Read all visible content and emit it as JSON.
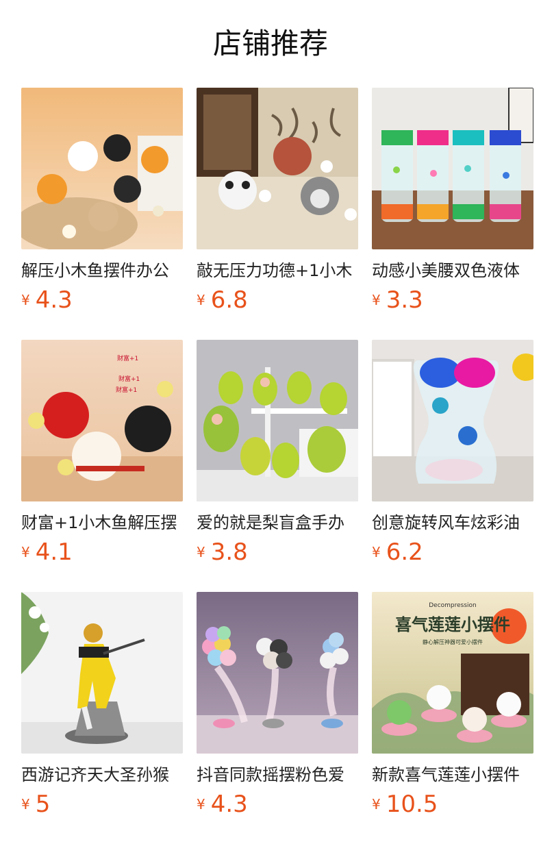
{
  "title": "店铺推荐",
  "products": [
    {
      "name": "解压小木鱼摆件办公",
      "currency": "¥",
      "price": "4.3"
    },
    {
      "name": "敲无压力功德+1小木",
      "currency": "¥",
      "price": "6.8"
    },
    {
      "name": "动感小美腰双色液体",
      "currency": "¥",
      "price": "3.3"
    },
    {
      "name": "财富+1小木鱼解压摆",
      "currency": "¥",
      "price": "4.1"
    },
    {
      "name": "爱的就是梨盲盒手办",
      "currency": "¥",
      "price": "3.8"
    },
    {
      "name": "创意旋转风车炫彩油",
      "currency": "¥",
      "price": "6.2"
    },
    {
      "name": "西游记齐天大圣孙猴",
      "currency": "¥",
      "price": "5"
    },
    {
      "name": "抖音同款摇摆粉色爱",
      "currency": "¥",
      "price": "4.3"
    },
    {
      "name": "新款喜气莲莲小摆件",
      "currency": "¥",
      "price": "10.5"
    }
  ],
  "image_text": {
    "banner_small": "Decompression",
    "banner_title": "喜气莲莲小摆件",
    "banner_sub": "静心解压神器可爱小摆件",
    "tag1": "财富+1",
    "tag2": "财富+1",
    "tag3": "财富+1"
  }
}
